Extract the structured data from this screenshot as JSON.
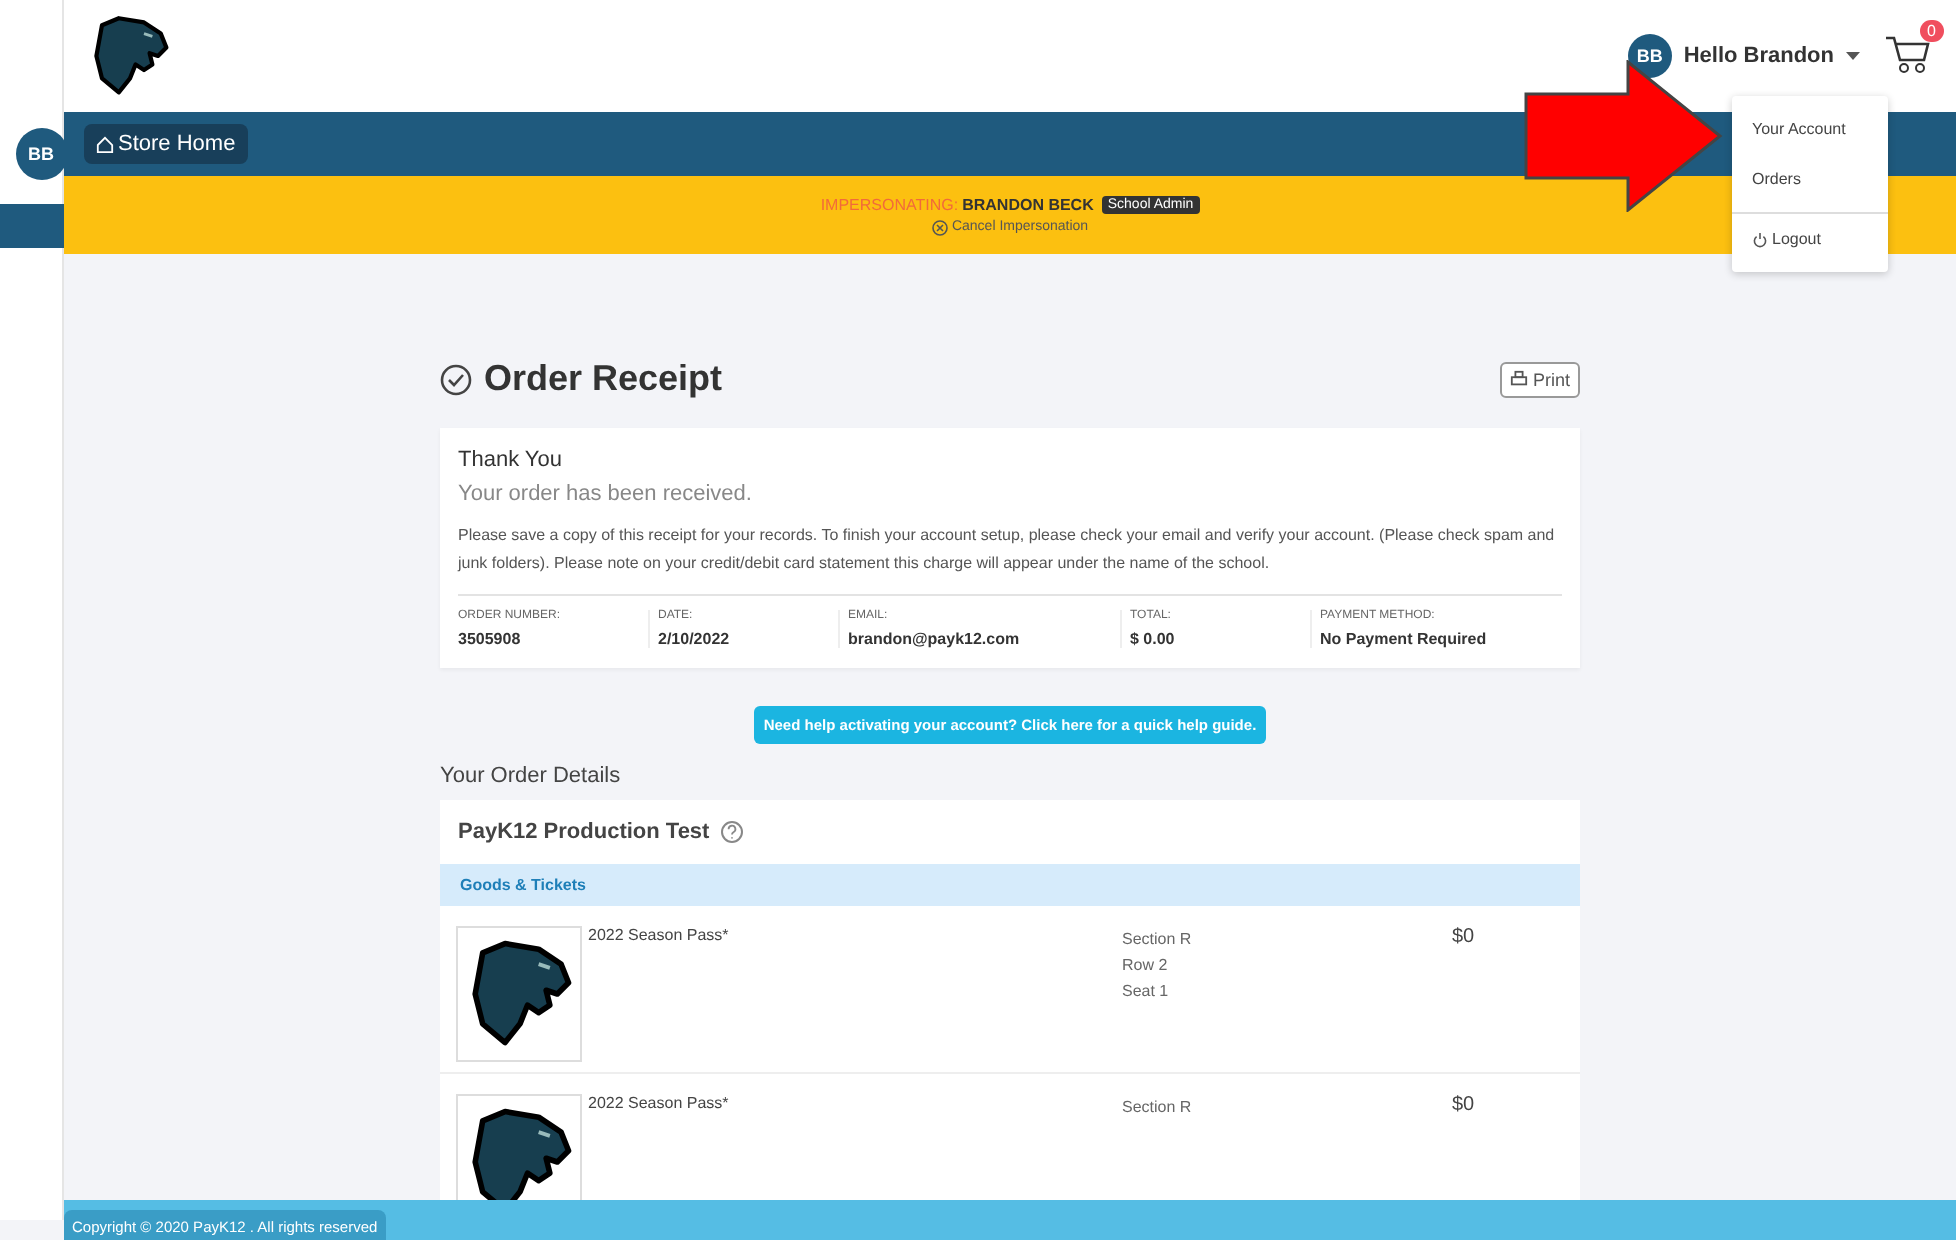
{
  "sidebar_avatar": "BB",
  "header": {
    "avatar": "BB",
    "greeting": "Hello Brandon",
    "cart_count": "0"
  },
  "user_menu": {
    "open": true,
    "items": [
      {
        "label": "Your Account",
        "kind": "link"
      },
      {
        "label": "Orders",
        "kind": "link"
      },
      {
        "label": "Logout",
        "kind": "logout"
      }
    ]
  },
  "nav": {
    "store_home": "Store Home"
  },
  "impersonation": {
    "prefix": "IMPERSONATING:",
    "name": "BRANDON BECK",
    "role": "School Admin",
    "cancel": "Cancel Impersonation"
  },
  "receipt": {
    "title": "Order Receipt",
    "print": "Print",
    "heading": "Thank You",
    "subheading": "Your order has been received.",
    "note": "Please save a copy of this receipt for your records. To finish your account setup, please check your email and verify your account. (Please check spam and junk folders). Please note on your credit/debit card statement this charge will appear under the name of the school.",
    "fields": [
      {
        "label": "ORDER NUMBER:",
        "value": "3505908"
      },
      {
        "label": "DATE:",
        "value": "2/10/2022"
      },
      {
        "label": "EMAIL:",
        "value": "brandon@payk12.com"
      },
      {
        "label": "TOTAL:",
        "value": "$ 0.00"
      },
      {
        "label": "PAYMENT METHOD:",
        "value": "No Payment Required"
      }
    ]
  },
  "help_button": "Need help activating your account? Click here for a quick help guide.",
  "order_details": {
    "title": "Your Order Details",
    "store": "PayK12 Production Test",
    "category": "Goods & Tickets",
    "items": [
      {
        "name": "2022 Season Pass*",
        "details": [
          "Section R",
          "Row 2",
          "Seat 1"
        ],
        "price": "$0"
      },
      {
        "name": "2022 Season Pass*",
        "details": [
          "Section R"
        ],
        "price": "$0"
      }
    ]
  },
  "footer": "Copyright © 2020 PayK12 . All rights reserved"
}
